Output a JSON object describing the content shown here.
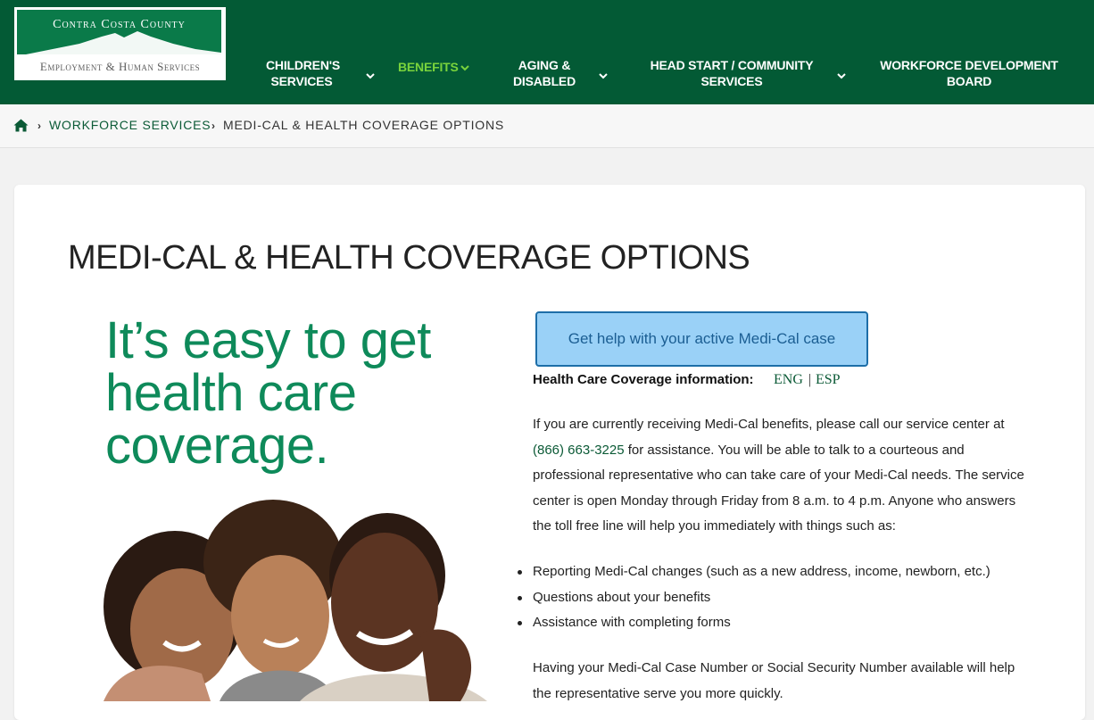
{
  "logo": {
    "line1": "Contra Costa County",
    "line2": "Employment & Human Services"
  },
  "nav": {
    "items": [
      {
        "label_line1": "CHILDREN'S",
        "label_line2": "SERVICES",
        "has_dropdown": true
      },
      {
        "label_line1": "BENEFITS",
        "label_line2": "",
        "has_dropdown": true,
        "active": true
      },
      {
        "label_line1": "AGING &",
        "label_line2": "DISABLED",
        "has_dropdown": true
      },
      {
        "label_line1": "HEAD START / COMMUNITY",
        "label_line2": "SERVICES",
        "has_dropdown": true
      },
      {
        "label_line1": "WORKFORCE DEVELOPMENT",
        "label_line2": "BOARD",
        "has_dropdown": false
      }
    ]
  },
  "breadcrumb": {
    "home_icon": "home-icon",
    "link": "WORKFORCE SERVICES",
    "current": "MEDI-CAL & HEALTH COVERAGE OPTIONS"
  },
  "page": {
    "title": "MEDI-CAL & HEALTH COVERAGE OPTIONS",
    "hero_line1": "It’s easy to get",
    "hero_line2": "health care",
    "hero_line3": "coverage.",
    "help_button": "Get help with your active Medi-Cal case",
    "coverage_label": "Health Care Coverage information:",
    "lang_eng": "ENG",
    "lang_sep": "|",
    "lang_esp": "ESP",
    "para1_before_phone": "If you are currently receiving Medi-Cal benefits, please call our service center at",
    "phone": "(866) 663-3225",
    "para1_after_phone": "for assistance. You will be able to talk to a courteous and professional representative who can take care of your Medi-Cal needs. The service center is open Monday through Friday from 8 a.m. to 4 p.m. Anyone who answers the toll free line will help you immediately with things such as:",
    "bullets": [
      "Reporting Medi-Cal changes (such as a new address, income, newborn, etc.)",
      "Questions about your benefits",
      "Assistance with completing forms"
    ],
    "para2": "Having your Medi-Cal Case Number or Social Security Number available will help the representative serve you more quickly."
  },
  "colors": {
    "header_bg": "#035a35",
    "nav_active": "#79d33c",
    "link": "#0b5a36",
    "hero_text": "#0e8a5a",
    "button_bg": "#9ad1f7"
  }
}
